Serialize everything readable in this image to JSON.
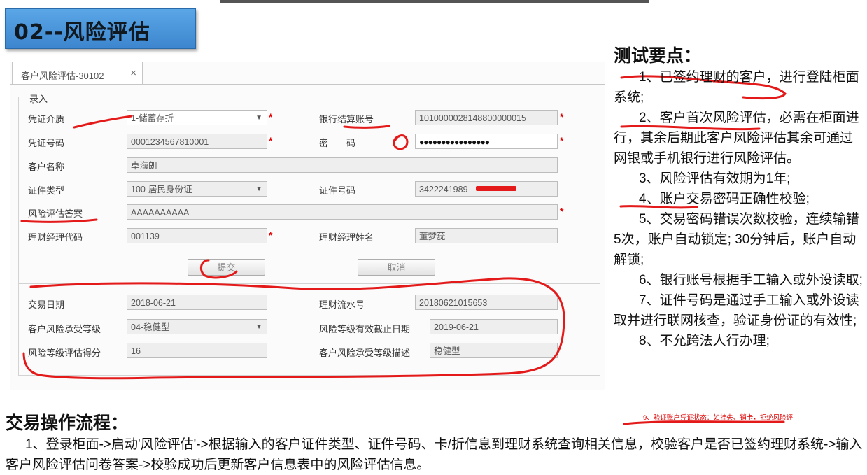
{
  "slide": {
    "title": "02--风险评估"
  },
  "window": {
    "tab_label": "客户风险评估-30102",
    "tab_close": "×",
    "group_legend": "录入"
  },
  "form": {
    "voucher_medium": {
      "label": "凭证介质",
      "value": "1-储蓄存折"
    },
    "bank_account": {
      "label": "银行结算账号",
      "value": "1010000028148800000015"
    },
    "voucher_no": {
      "label": "凭证号码",
      "value": "0001234567810001"
    },
    "password": {
      "label": "密　　码",
      "value": "●●●●●●●●●●●●●●●●"
    },
    "customer_name": {
      "label": "客户名称",
      "value": "卓海朗"
    },
    "id_type": {
      "label": "证件类型",
      "value": "100-居民身份证"
    },
    "id_number": {
      "label": "证件号码",
      "value": "3422241989"
    },
    "risk_answer": {
      "label": "风险评估答案",
      "value": "AAAAAAAAAA"
    },
    "manager_code": {
      "label": "理财经理代码",
      "value": "001139"
    },
    "manager_name": {
      "label": "理财经理姓名",
      "value": "董梦莸"
    },
    "submit_label": "提交",
    "cancel_label": "取消"
  },
  "result": {
    "trade_date": {
      "label": "交易日期",
      "value": "2018-06-21"
    },
    "serial_no": {
      "label": "理财流水号",
      "value": "20180621015653"
    },
    "risk_level": {
      "label": "客户风险承受等级",
      "value": "04-稳健型"
    },
    "expiry_date": {
      "label": "风险等级有效截止日期",
      "value": "2019-06-21"
    },
    "score": {
      "label": "风险等级评估得分",
      "value": "16"
    },
    "level_desc": {
      "label": "客户风险承受等级描述",
      "value": "稳健型"
    }
  },
  "notes": {
    "title": "测试要点：",
    "items": [
      "1、已签约理财的客户，进行登陆柜面系统;",
      "2、客户首次风险评估，必需在柜面进行，其余后期此客户风险评估其余可通过网银或手机银行进行风险评估。",
      "3、风险评估有效期为1年;",
      "4、账户交易密码正确性校验;",
      "5、交易密码错误次数校验，连续输错5次，账户自动锁定; 30分钟后，账户自动解锁;",
      "6、银行账号根据手工输入或外设读取;",
      "7、证件号码是通过手工输入或外设读取并进行联网核查，验证身份证的有效性;",
      "8、不允跨法人行办理;"
    ],
    "item9": "9、验证账户凭证状态：如挂失、销卡，拒绝风险评"
  },
  "flow": {
    "title": "交易操作流程：",
    "text": "1、登录柜面->启动'风险评估'->根据输入的客户证件类型、证件号码、卡/折信息到理财系统查询相关信息，校验客户是否已签约理财系统->输入客户风险评估问卷答案->校验成功后更新客户信息表中的风险评估信息。"
  },
  "colors": {
    "title_bg": "#4a96dc",
    "required_star": "#e00000",
    "annotation_ink": "#e41a1a"
  }
}
